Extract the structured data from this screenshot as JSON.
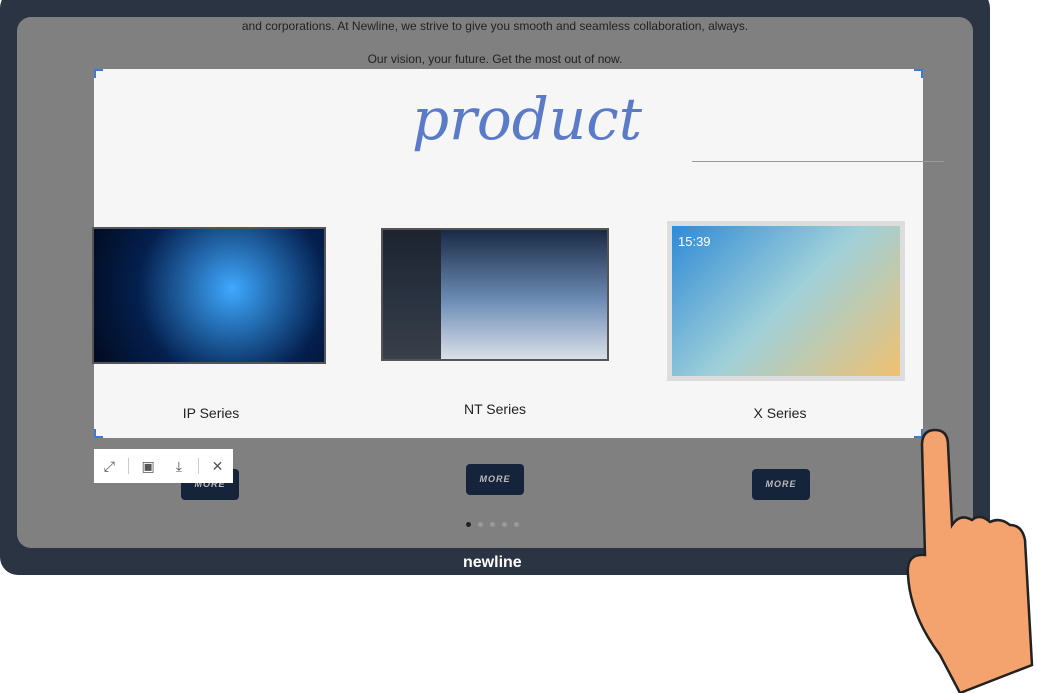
{
  "page_text": {
    "line1": "and corporations. At Newline, we strive to give you smooth and seamless collaboration, always.",
    "line2": "Our vision, your future. Get the most out of now."
  },
  "handwriting": "product",
  "products": [
    {
      "name": "IP Series",
      "more": "MORE"
    },
    {
      "name": "NT Series",
      "more": "MORE"
    },
    {
      "name": "X Series",
      "more": "MORE"
    }
  ],
  "x_series_clock": "15:39",
  "toolbar": {
    "icons": [
      "expand-icon",
      "screen-share-icon",
      "download-icon",
      "close-icon"
    ]
  },
  "carousel": {
    "pages": 5,
    "current": 1
  },
  "brand": "newline",
  "colors": {
    "bezel": "#2a3442",
    "accent": "#3a7bd5",
    "button": "#15243a",
    "hand": "#f4a36f"
  }
}
